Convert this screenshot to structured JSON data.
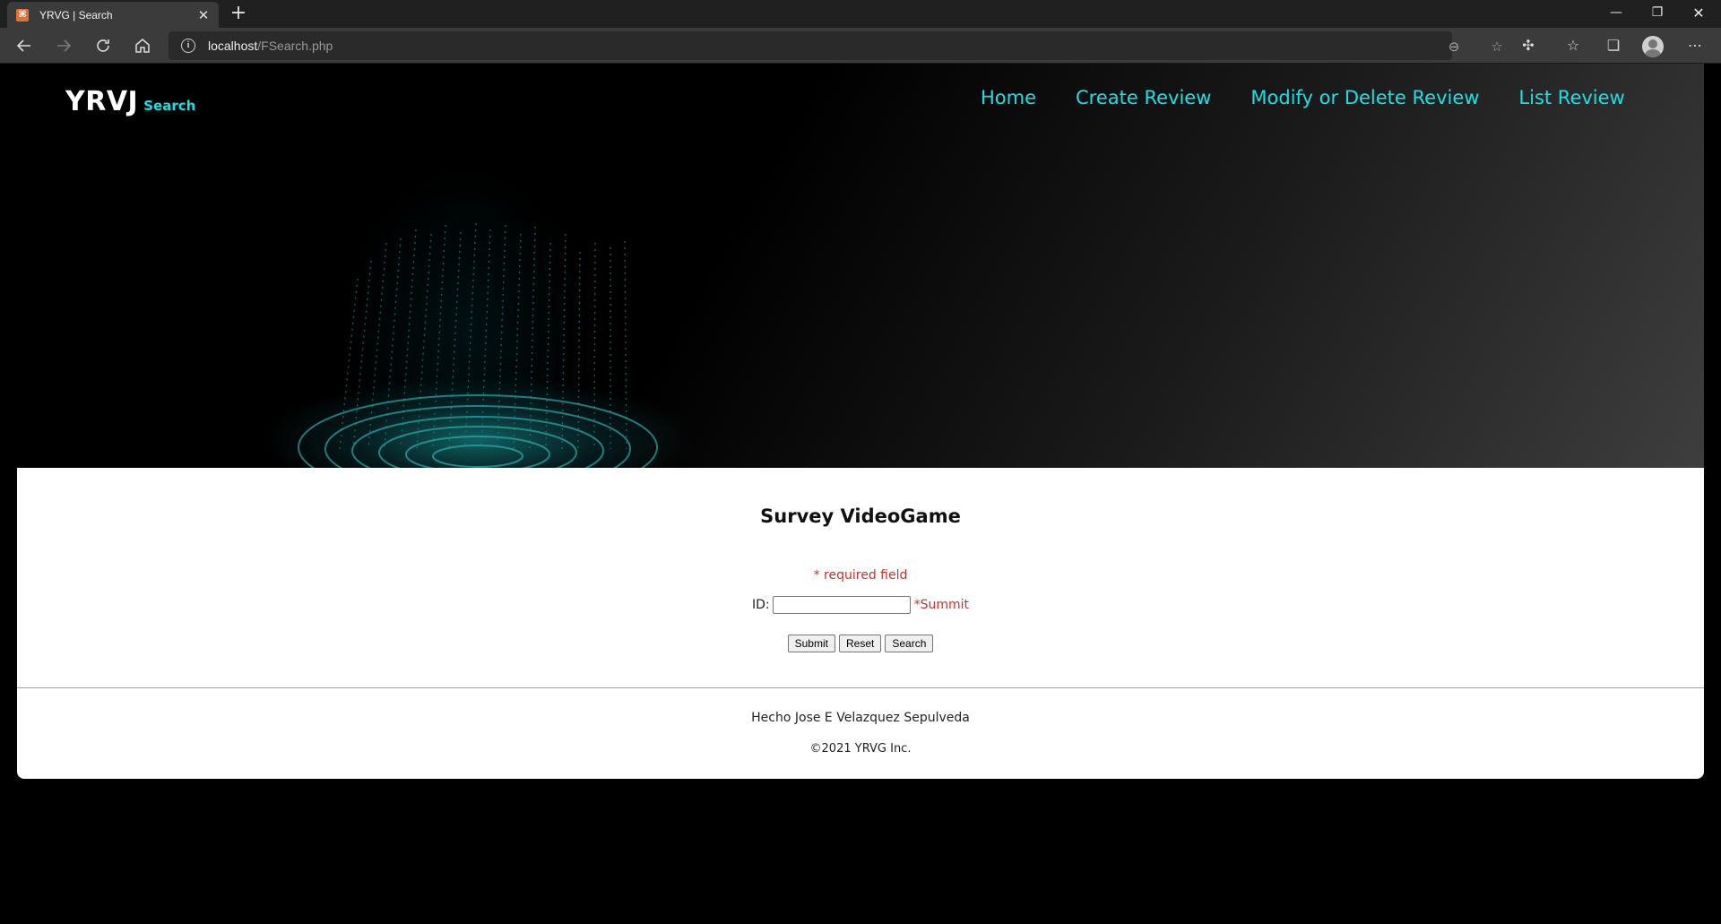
{
  "browser": {
    "tab_title": "YRVG | Search",
    "favicon_icon": "xampp-icon",
    "address_host": "localhost",
    "address_path": "/FSearch.php"
  },
  "site": {
    "brand": "YRVJ",
    "brand_sub": "Search",
    "accent_color": "#19e0e6",
    "nav": [
      {
        "label": "Home"
      },
      {
        "label": "Create Review"
      },
      {
        "label": "Modify or Delete Review"
      },
      {
        "label": "List Review"
      }
    ]
  },
  "form": {
    "title": "Survey VideoGame",
    "required_note": "* required field",
    "id_label": "ID:",
    "id_value": "",
    "id_error": "*Summit",
    "buttons": {
      "submit": "Submit",
      "reset": "Reset",
      "search": "Search"
    },
    "error_color": "#c8312c"
  },
  "footer": {
    "credit": "Hecho Jose E Velazquez Sepulveda",
    "copyright": "©2021 YRVG Inc."
  }
}
